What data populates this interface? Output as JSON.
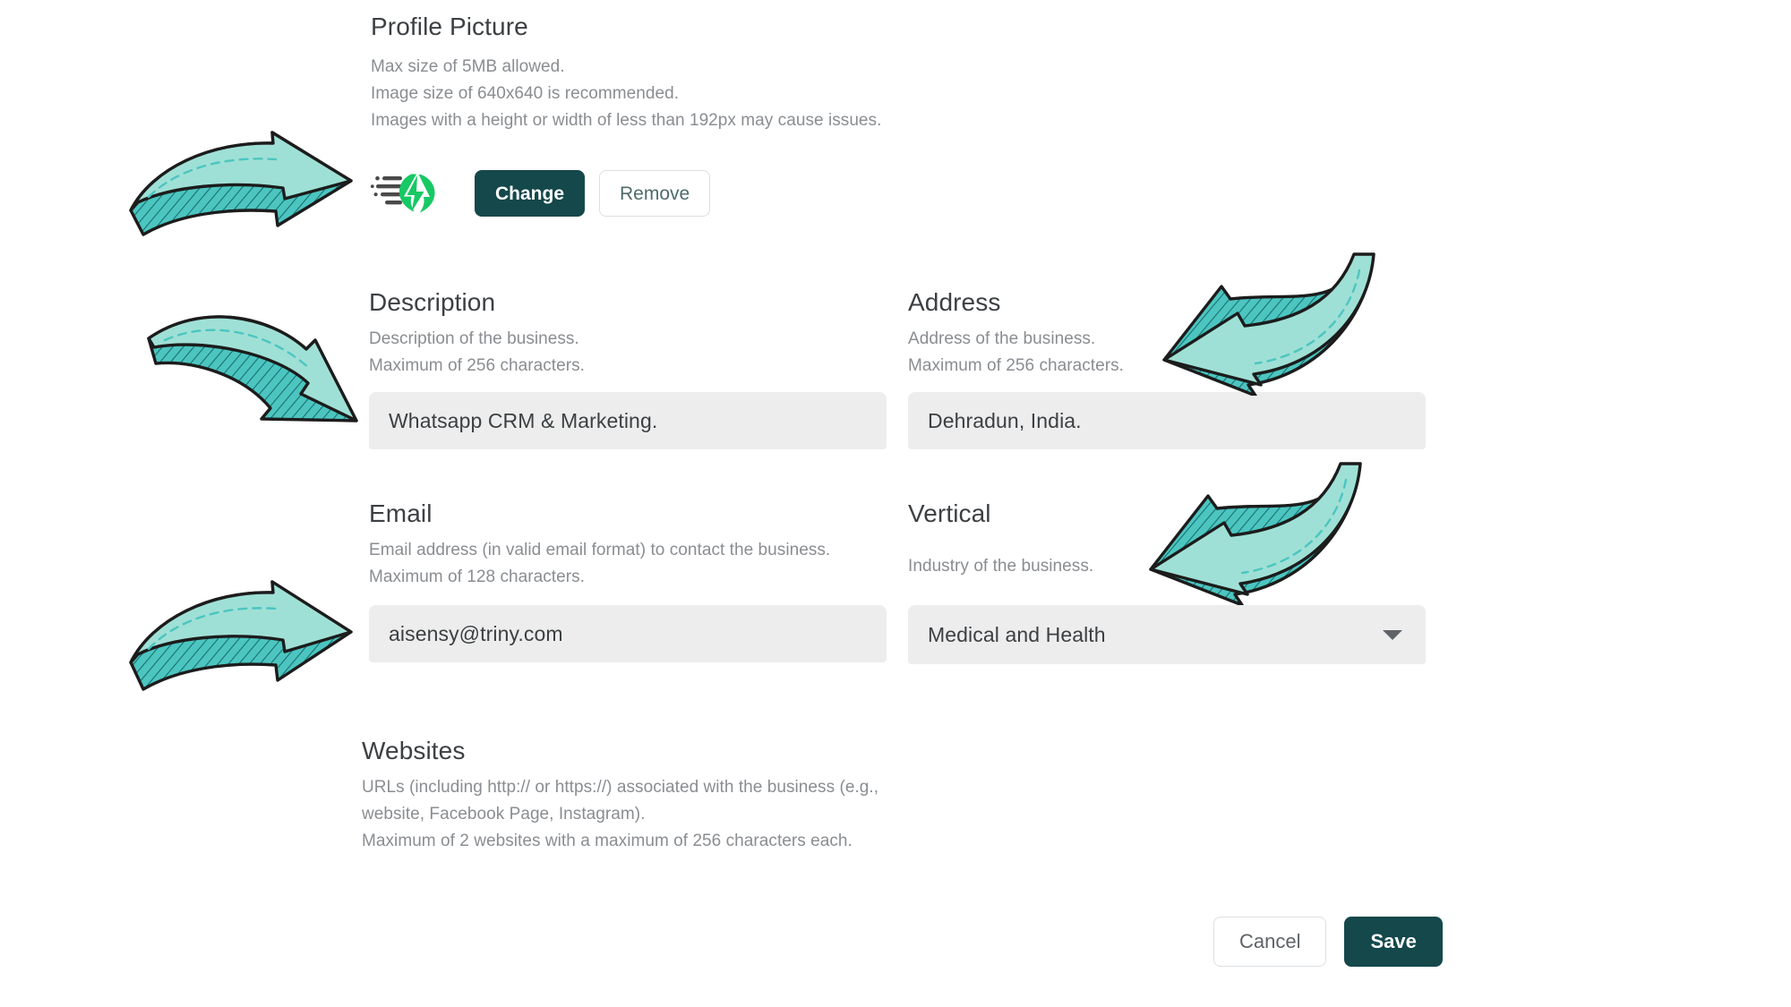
{
  "profile_picture": {
    "title": "Profile Picture",
    "helper": [
      "Max size of 5MB allowed.",
      "Image size of 640x640 is recommended.",
      "Images with a height or width of less than 192px may cause issues."
    ],
    "logo_name": "aisensy-logo-icon",
    "change_label": "Change",
    "remove_label": "Remove"
  },
  "description": {
    "title": "Description",
    "helper": [
      "Description of the business.",
      "Maximum of 256 characters."
    ],
    "value": "Whatsapp CRM & Marketing."
  },
  "address": {
    "title": "Address",
    "helper": [
      "Address of the business.",
      "Maximum of 256 characters."
    ],
    "value": "Dehradun, India."
  },
  "email": {
    "title": "Email",
    "helper": [
      "Email address (in valid email format) to contact the business.",
      "Maximum of 128 characters."
    ],
    "value": "aisensy@triny.com"
  },
  "vertical": {
    "title": "Vertical",
    "helper": [
      "Industry of the business."
    ],
    "value": "Medical and Health"
  },
  "websites": {
    "title": "Websites",
    "helper": [
      "URLs (including http:// or https://) associated with the business (e.g., website, Facebook Page, Instagram).",
      "Maximum of 2 websites with a maximum of 256 characters each."
    ]
  },
  "footer": {
    "cancel_label": "Cancel",
    "save_label": "Save"
  },
  "annotations": {
    "arrows": [
      {
        "name": "arrow-to-profile-picture",
        "direction": "right"
      },
      {
        "name": "arrow-to-description",
        "direction": "down-right"
      },
      {
        "name": "arrow-to-email",
        "direction": "right"
      },
      {
        "name": "arrow-to-address",
        "direction": "down-left"
      },
      {
        "name": "arrow-to-vertical",
        "direction": "down-left"
      }
    ]
  },
  "colors": {
    "primary_dark_teal": "#14484b",
    "logo_green": "#17c964",
    "input_background": "#ededed",
    "helper_text": "#8a8d91",
    "title_text": "#3c4043",
    "arrow_fill": "#9fe0d6",
    "arrow_shadow": "#4cc5c0",
    "arrow_outline": "#1c1c1c"
  }
}
